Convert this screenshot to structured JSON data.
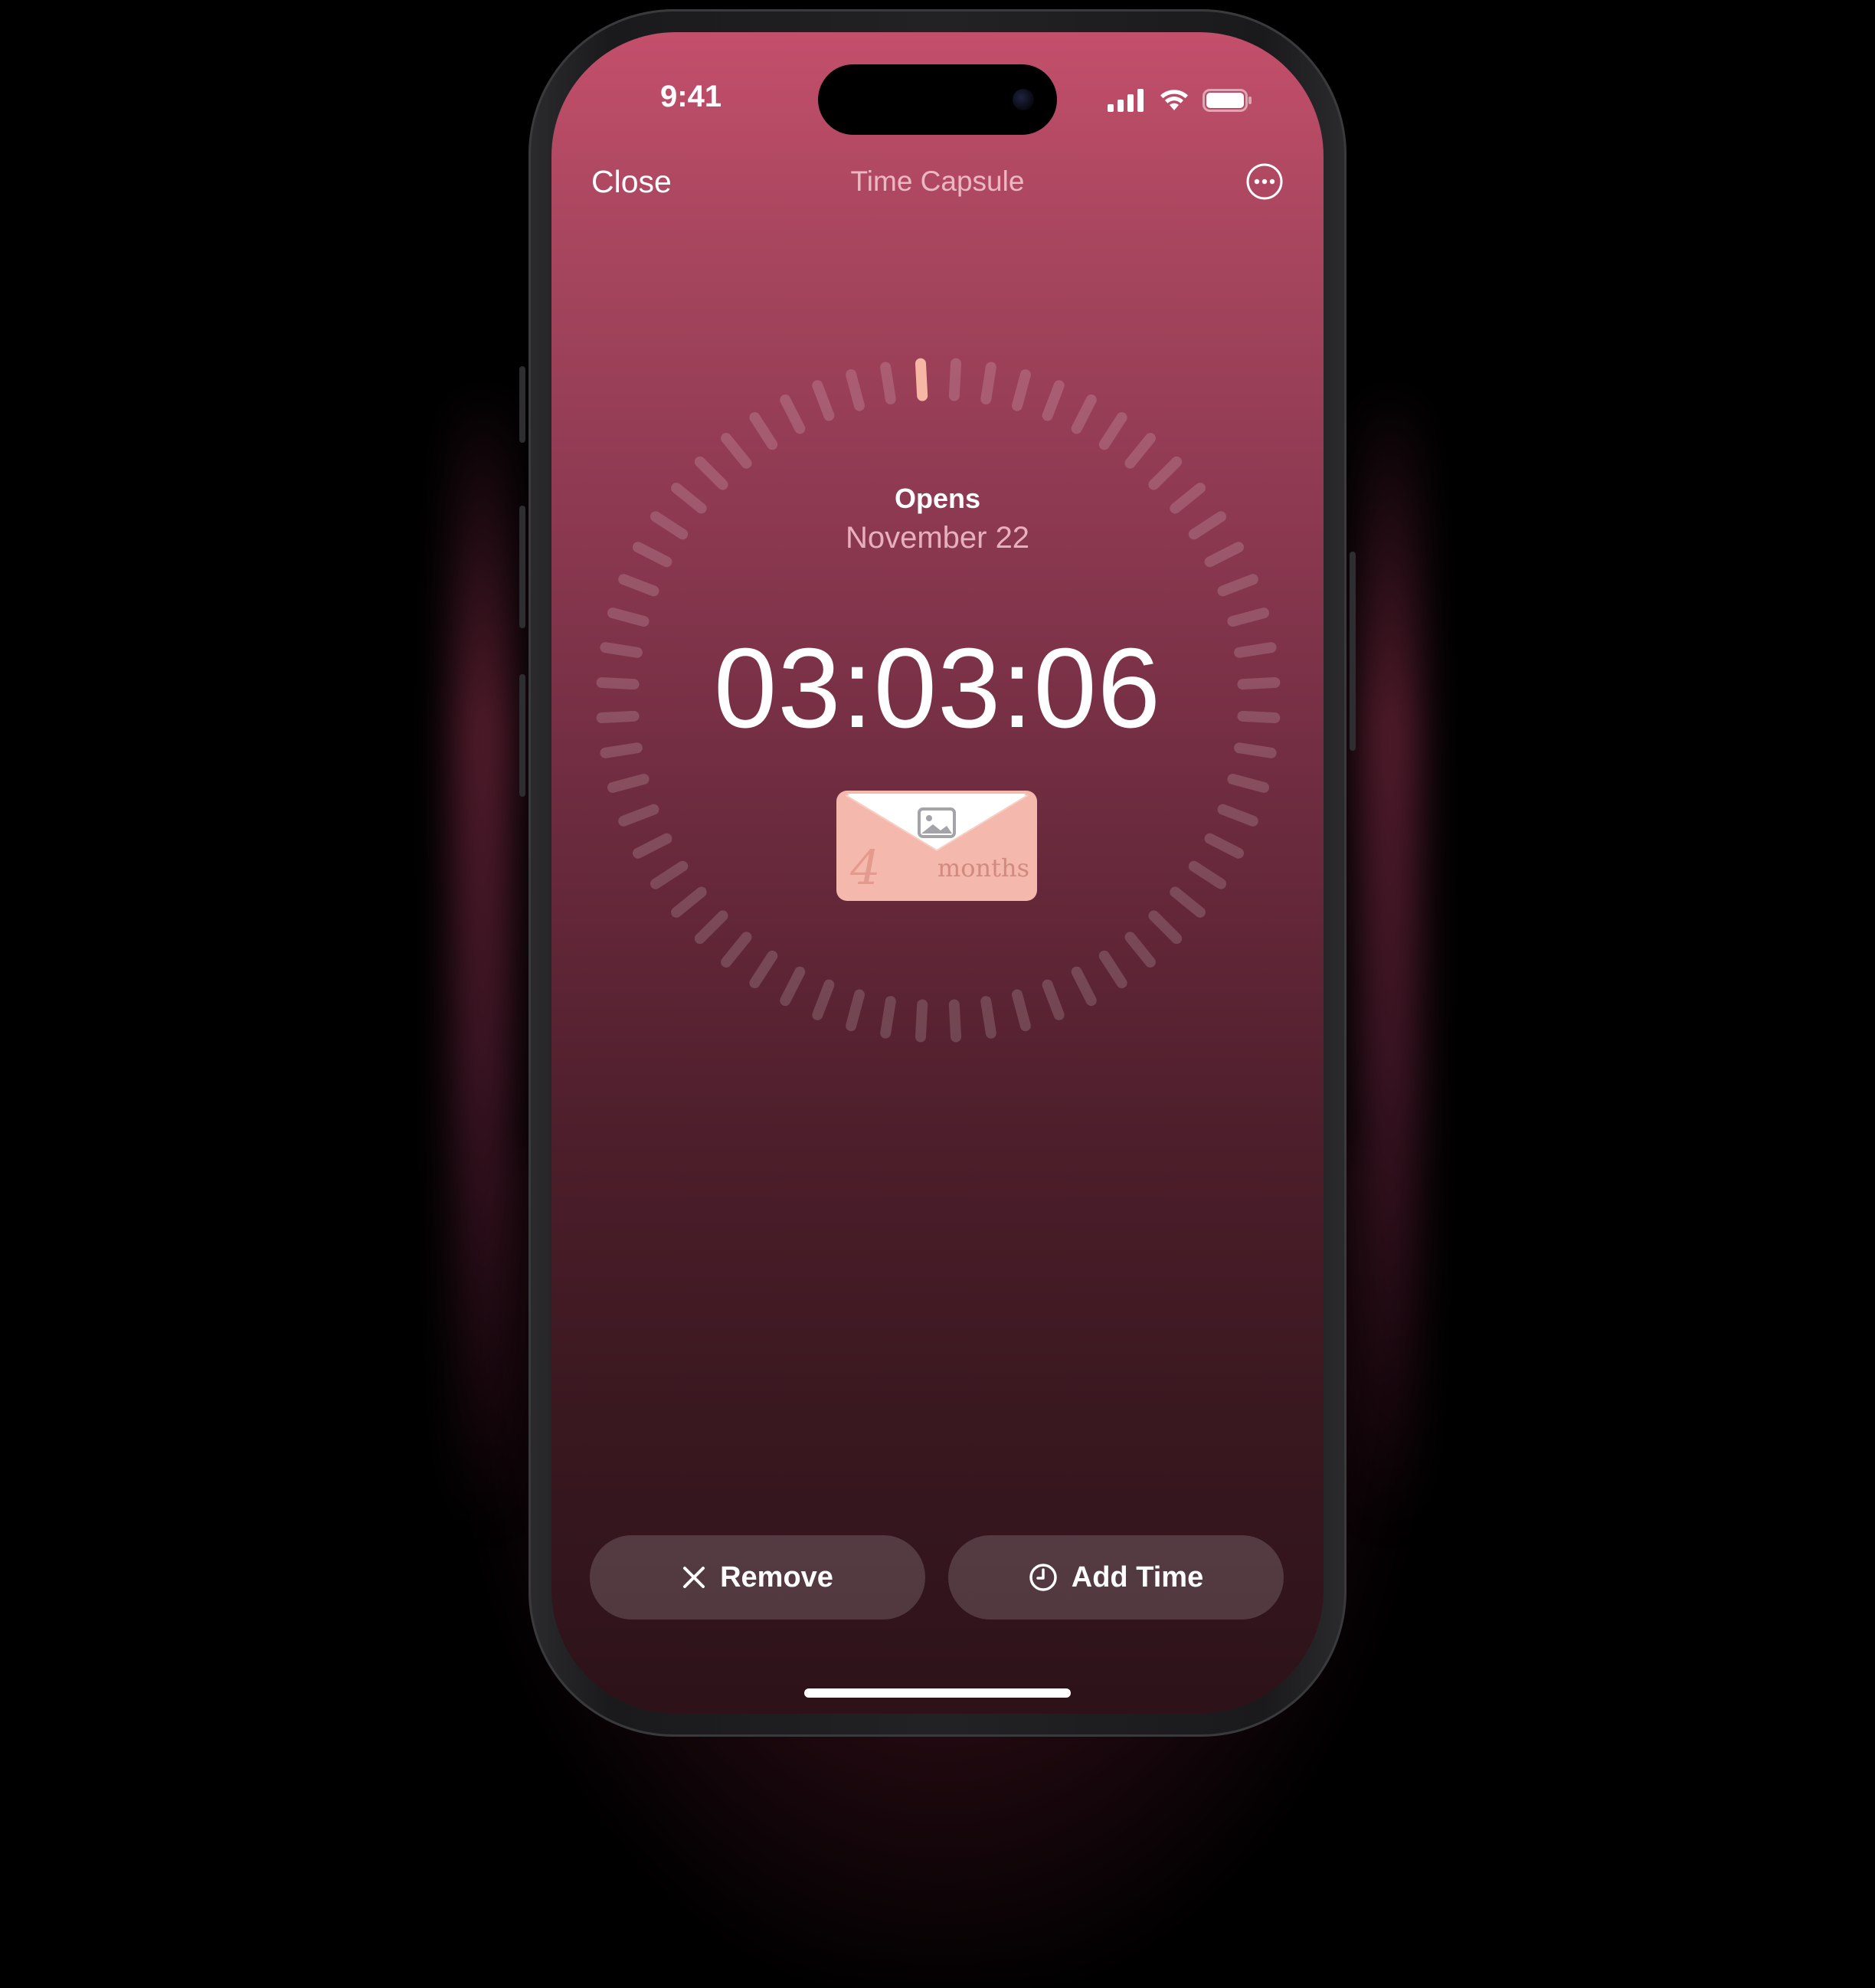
{
  "status_bar": {
    "time": "9:41",
    "icons": [
      "cellular-signal-icon",
      "wifi-icon",
      "battery-icon"
    ]
  },
  "nav": {
    "close_label": "Close",
    "title": "Time Capsule",
    "more_icon": "ellipsis-circle-icon"
  },
  "capsule": {
    "opens_label": "Opens",
    "opens_date": "November 22",
    "countdown": "03:03:06",
    "envelope": {
      "number": "4",
      "unit": "months",
      "icon": "photo-icon"
    },
    "dial_ticks": 60,
    "dial_progress_fraction": 0.0
  },
  "actions": {
    "remove_label": "Remove",
    "remove_icon": "x-mark-icon",
    "add_time_label": "Add Time",
    "add_time_icon": "clock-icon"
  },
  "colors": {
    "background_top": "#c34f6b",
    "background_bottom": "#2d121a",
    "envelope": "#f4b8ac",
    "active_tick": "#f6b7a4"
  }
}
